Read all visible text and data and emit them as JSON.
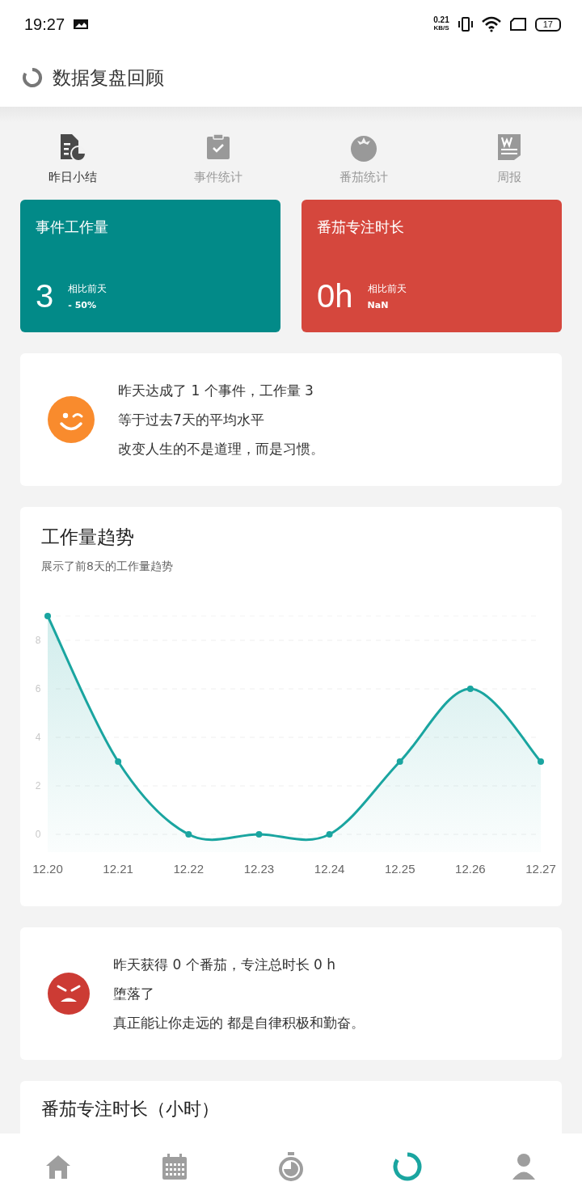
{
  "status_bar": {
    "time": "19:27",
    "speed": "0.21",
    "speed_unit": "KB/S",
    "battery": "17"
  },
  "header": {
    "title": "数据复盘回顾"
  },
  "tabs": [
    {
      "label": "昨日小结",
      "kind": "report",
      "selected": true
    },
    {
      "label": "事件统计",
      "kind": "clipboard",
      "selected": false
    },
    {
      "label": "番茄统计",
      "kind": "tomato",
      "selected": false
    },
    {
      "label": "周报",
      "kind": "weekly",
      "selected": false
    }
  ],
  "stat_cards": [
    {
      "title": "事件工作量",
      "value": "3",
      "compare_label": "相比前天",
      "compare_value": "- 50%",
      "color": "#028a88"
    },
    {
      "title": "番茄专注时长",
      "value": "0h",
      "compare_label": "相比前天",
      "compare_value": "NaN",
      "color": "#d5473d"
    }
  ],
  "summaries": [
    {
      "kind": "happy",
      "color": "#f98b2d",
      "lines": [
        "昨天达成了 1 个事件，工作量 3",
        "等于过去7天的平均水平",
        "改变人生的不是道理，而是习惯。"
      ]
    }
  ],
  "trend": {
    "title": "工作量趋势",
    "subtitle": "展示了前8天的工作量趋势",
    "chart_data": {
      "type": "area",
      "categories": [
        "12.20",
        "12.21",
        "12.22",
        "12.23",
        "12.24",
        "12.25",
        "12.26",
        "12.27"
      ],
      "series": [
        {
          "color": "#1aa5a0",
          "values": [
            9,
            3,
            0,
            0,
            0,
            3,
            6,
            3
          ]
        }
      ],
      "yticks": [
        0,
        2,
        4,
        6,
        8
      ],
      "ylim": [
        0,
        9
      ],
      "grid": true
    }
  },
  "summaries_2": [
    {
      "kind": "angry",
      "color": "#cc3b34",
      "lines": [
        "昨天获得 0 个番茄，专注总时长 0 h",
        "堕落了",
        "真正能让你走远的 都是自律积极和勤奋。"
      ]
    }
  ],
  "partial_card": {
    "title": "番茄专注时长（小时）"
  },
  "bottom_nav": [
    {
      "kind": "home",
      "selected": false
    },
    {
      "kind": "calendar",
      "selected": false
    },
    {
      "kind": "stopwatch",
      "selected": false
    },
    {
      "kind": "ring",
      "selected": true
    },
    {
      "kind": "person",
      "selected": false
    }
  ]
}
